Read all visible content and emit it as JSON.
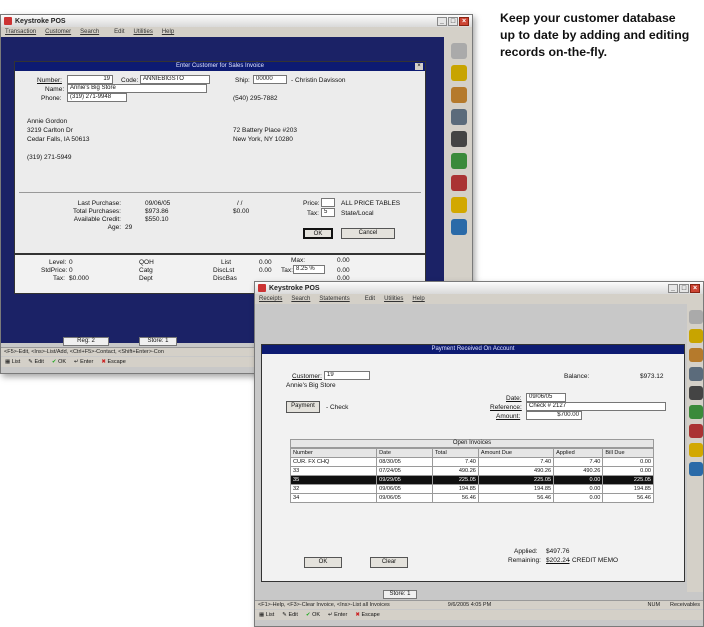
{
  "caption": "Keep your customer database up to date by adding and editing records on-the-fly.",
  "win1": {
    "title": "Keystroke POS",
    "menu": [
      "Transaction",
      "Customer",
      "Search",
      "Edit",
      "Utilities",
      "Help"
    ],
    "dialog_title": "Enter Customer for Sales Invoice",
    "labels": {
      "number": "Number:",
      "code": "Code:",
      "ship": "Ship:",
      "name": "Name:",
      "phone": "Phone:"
    },
    "number": "19",
    "code": "ANNIEBIGSTO",
    "ship": "00000",
    "ship_name": "- Christin Davisson",
    "name": "Annie's Big Store",
    "phone": "(319) 271-9948",
    "phone2": "(540) 295-7882",
    "bill_address": [
      "Annie Gordon",
      "3219 Carlton Dr",
      "Cedar Falls, IA 50613",
      "",
      "(319) 271-5949"
    ],
    "ship_address": [
      "72 Battery Place #203",
      "New York, NY 10280"
    ],
    "stats": {
      "last_purchase_label": "Last Purchase:",
      "last_purchase": "09/06/05",
      "last_purchase_2": "/ /",
      "total_purchases_label": "Total Purchases:",
      "total_purchases": "$973.86",
      "total_purchases_2": "$0.00",
      "available_credit_label": "Available Credit:",
      "available_credit": "$550.10",
      "age_label": "Age:",
      "age": "29"
    },
    "price_label": "Price:",
    "price_value": "",
    "all_price_tables": "ALL PRICE TABLES",
    "tax_label": "Tax:",
    "tax_value": "5",
    "tax_desc": "State/Local",
    "ok": "OK",
    "cancel": "Cancel",
    "grid": {
      "level_label": "Level:",
      "level": "0",
      "stdprice_label": "StdPrice:",
      "stdprice": "0",
      "tax_label": "Tax:",
      "tax": "$0.000",
      "qoh": "QOH",
      "catg": "Catg",
      "dept": "Dept",
      "list": "List",
      "disclist": "DiscLst",
      "discbas": "DiscBas",
      "v1": "0.00",
      "v2": "0.00",
      "tax2_label": "Tax:",
      "tax2": "8.25 %",
      "max_label": "Max:",
      "r1": "0.00",
      "r2": "0.00",
      "r3": "0.00"
    },
    "reg": "Reg: 2",
    "store": "Store: 1",
    "status": "<F5>-Edit, <Ins>-List/Add, <Ctrl+F5>-Contact, <Shift+Enter>-Con",
    "buttons": [
      "List",
      "Edit",
      "OK",
      "Enter",
      "Escape"
    ]
  },
  "win2": {
    "title": "Keystroke POS",
    "menu": [
      "Receipts",
      "Search",
      "Statements",
      "Edit",
      "Utilities",
      "Help"
    ],
    "dialog_title": "Payment Received On Account",
    "customer_label": "Customer:",
    "customer": "19",
    "customer_name": "Annie's Big Store",
    "balance_label": "Balance:",
    "balance": "$973.12",
    "payment": "Payment",
    "payment_type": "- Check",
    "date_label": "Date:",
    "date": "09/06/05",
    "reference_label": "Reference:",
    "reference": "Check # 2127",
    "amount_label": "Amount:",
    "amount": "$700.00",
    "table_title": "Open Invoices",
    "columns": [
      "Number",
      "Date",
      "Total",
      "Amount Due",
      "Applied",
      "Bill Due"
    ],
    "rows": [
      [
        "CUR. FX CHQ",
        "08/30/05",
        "7.40",
        "7.40",
        "7.40",
        "0.00"
      ],
      [
        "33",
        "07/24/05",
        "490.26",
        "490.26",
        "490.26",
        "0.00"
      ],
      [
        "35",
        "09/29/05",
        "225.05",
        "225.05",
        "0.00",
        "225.05"
      ],
      [
        "32",
        "09/06/05",
        "194.85",
        "194.85",
        "0.00",
        "194.85"
      ],
      [
        "34",
        "09/06/05",
        "56.46",
        "56.46",
        "0.00",
        "56.46"
      ]
    ],
    "applied_label": "Applied:",
    "applied": "$497.76",
    "remaining_label": "Remaining:",
    "remaining": "$202.24",
    "remaining_note": "- CREDIT MEMO",
    "ok": "OK",
    "clear": "Clear",
    "store": "Store: 1",
    "status": "<F1>-Help, <F3>-Clear Invoice, <Ins>-List all Invoices",
    "status_date": "9/6/2005  4:05 PM",
    "status_num": "NUM",
    "status_app": "Receivables",
    "buttons": [
      "List",
      "Edit",
      "OK",
      "Enter",
      "Escape"
    ]
  }
}
